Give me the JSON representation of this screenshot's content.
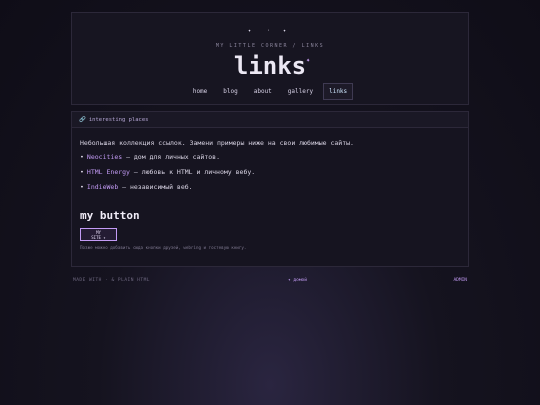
{
  "header": {
    "sparkles": [
      "✦",
      "·",
      "✦"
    ],
    "kicker": "MY LITTLE CORNER / LINKS",
    "title": "links",
    "title_star": "✦",
    "nav": [
      {
        "label": "home",
        "active": false
      },
      {
        "label": "blog",
        "active": false
      },
      {
        "label": "about",
        "active": false
      },
      {
        "label": "gallery",
        "active": false
      },
      {
        "label": "links",
        "active": true
      }
    ]
  },
  "card": {
    "heading_icon": "🔗",
    "heading": "interesting places",
    "intro": "Небольшая коллекция ссылок. Замени примеры ниже на свои любимые сайты.",
    "items": [
      {
        "bullet": "•",
        "link": "Neocities",
        "text": " — дом для личных сайтов."
      },
      {
        "bullet": "•",
        "link": "HTML Energy",
        "text": " — любовь к HTML и личному вебу."
      },
      {
        "bullet": "•",
        "link": "IndieWeb",
        "text": " — независимый веб."
      }
    ],
    "button_title": "my button",
    "button_line1": "MY",
    "button_line2": "SITE ✦",
    "note": "Позже можно добавить сюда кнопки друзей, webring и гостевую книгу."
  },
  "footer": {
    "left": "MADE WITH · & PLAIN HTML",
    "middle": "✦ домой",
    "right": "ADMIN"
  },
  "colors": {
    "accent": "#c39bf5",
    "background": "#0f0d17",
    "panel": "#171521"
  }
}
